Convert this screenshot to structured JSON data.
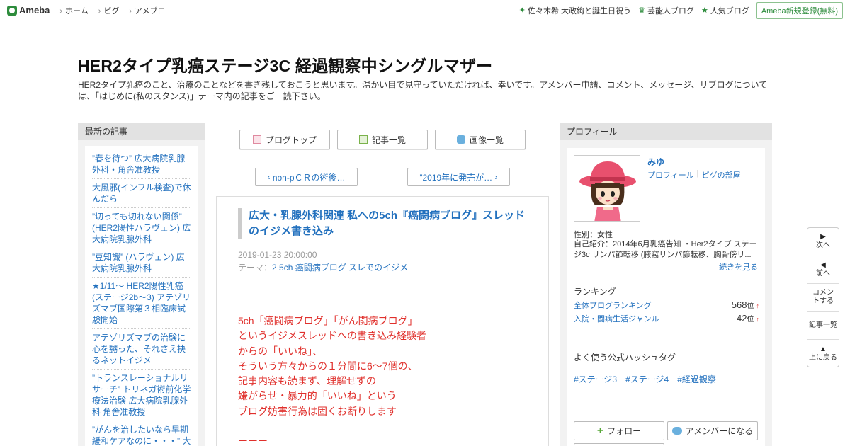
{
  "topbar": {
    "logo": "Ameba",
    "nav": [
      "ホーム",
      "ピグ",
      "アメブロ"
    ],
    "right_links": [
      "佐々木希 大政絢と誕生日祝う",
      "芸能人ブログ",
      "人気ブログ"
    ],
    "signup": "Ameba新規登録(無料)"
  },
  "header": {
    "title": "HER2タイプ乳癌ステージ3C 経過観察中シングルマザー",
    "description": "HER2タイプ乳癌のこと、治療のことなどを書き残しておこうと思います。温かい目で見守っていただければ、幸いです。アメンバー申請、コメント、メッセージ、リブログについては、「はじめに(私のスタンス)」テーマ内の記事をご一読下さい。"
  },
  "left": {
    "heading": "最新の記事",
    "items": [
      "”春を待つ” 広大病院乳腺外科・角舎准教授",
      "大風邪(インフル検査)で休んだら",
      "”切っても切れない関係” (HER2陽性ハラヴェン) 広大病院乳腺外科",
      "”豆知識” (ハラヴェン) 広大病院乳腺外科",
      "★1/11～ HER2陽性乳癌(ステージ2b～3) アテゾリズマブ国際第３相臨床試験開始",
      "アテゾリズマブの治験に心を嬲った、それさえ抉るネットイジメ",
      "”トランスレーショナルリサーチ” トリネガ術前化学療法治験 広大病院乳腺外科 角舎准教授",
      "”がんを治したいなら早期緩和ケアなのに・・・” 大津秀一緩和医"
    ]
  },
  "center": {
    "buttons": [
      "ブログトップ",
      "記事一覧",
      "画像一覧"
    ],
    "prev": "non-pＣＲの術後…",
    "next": "”2019年に発売が…",
    "article": {
      "title": "広大・乳腺外科関連 私への5ch『癌闘病ブログ』スレッドのイジメ書き込み",
      "date": "2019-01-23 20:00:00",
      "theme_label": "テーマ：",
      "theme": "2 5ch 癌闘病ブログ スレでのイジメ",
      "body": [
        "5ch「癌闘病ブログ」「がん闘病ブログ」",
        "というイジメスレッドへの書き込み経験者",
        "からの「いいね」、",
        "そういう方々からの１分間に6～7個の、",
        "記事内容も読まず、理解せずの",
        "嫌がらせ・暴力的「いいね」という",
        "ブログ妨害行為は固くお断りします",
        "",
        "ーーー"
      ]
    }
  },
  "right": {
    "heading": "プロフィール",
    "name": "みゆ",
    "links": [
      "プロフィール",
      "ピグの部屋"
    ],
    "gender": "性別：女性",
    "intro": "自己紹介：2014年6月乳癌告知 ・Her2タイプ ステージ3c リンパ節転移 (腋窩リンパ節転移、胸骨傍リ...",
    "more": "続きを見る",
    "ranking_heading": "ランキング",
    "rankings": [
      {
        "label": "全体ブログランキング",
        "value": "568",
        "unit": "位",
        "trend": "↑"
      },
      {
        "label": "入院・闘病生活ジャンル",
        "value": "42",
        "unit": "位",
        "trend": "↑"
      }
    ],
    "hashtag_heading": "よく使う公式ハッシュタグ",
    "hashtags": [
      "#ステージ3",
      "#ステージ4",
      "#経過観察"
    ],
    "follow": "フォロー",
    "amember": "アメンバーになる"
  },
  "float_nav": [
    "次へ",
    "前へ",
    "コメントする",
    "記事一覧",
    "上に戻る"
  ],
  "colors": {
    "accent": "#2371be",
    "brand": "#2d8c3c",
    "article_text": "#e0302c"
  }
}
